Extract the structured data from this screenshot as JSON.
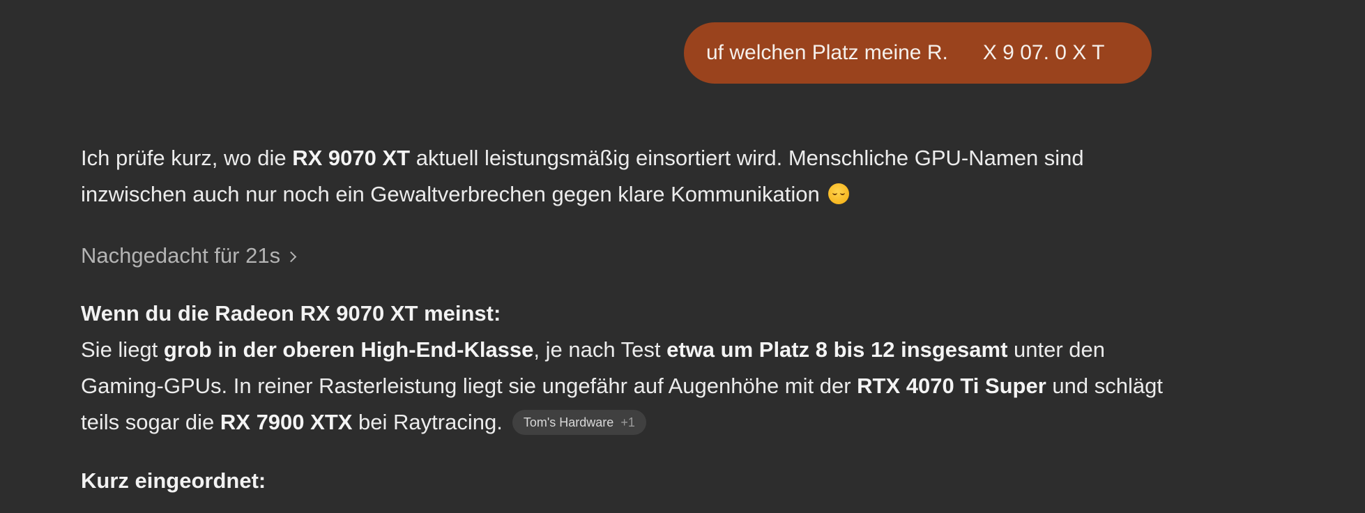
{
  "user_message": {
    "text": "uf welchen Platz meine R.      X 9 07. 0 X T"
  },
  "assistant": {
    "intro": {
      "part1": "Ich prüfe kurz, wo die ",
      "bold1": "RX 9070 XT",
      "part2": " aktuell leistungsmäßig einsortiert wird. Menschliche GPU-Namen sind inzwischen auch nur noch ein Gewaltverbrechen gegen klare Kommunikation ",
      "emoji": "relieved-face-emoji"
    },
    "thought_label": "Nachgedacht für 21s",
    "heading1": "Wenn du die Radeon RX 9070 XT meinst:",
    "body": {
      "t1": "Sie liegt ",
      "b1": "grob in der oberen High-End-Klasse",
      "t2": ", je nach Test ",
      "b2": "etwa um Platz 8 bis 12 insgesamt",
      "t3": " unter den Gaming-GPUs. In reiner Rasterleistung liegt sie ungefähr auf Augenhöhe mit der ",
      "b3": "RTX 4070 Ti Super",
      "t4": " und schlägt teils sogar die ",
      "b4": "RX 7900 XTX",
      "t5": " bei Raytracing."
    },
    "source": {
      "name": "Tom's Hardware",
      "count": "+1"
    },
    "heading2": "Kurz eingeordnet:"
  },
  "colors": {
    "background": "#2d2d2d",
    "user_bubble": "#9a431d",
    "text": "#ececec",
    "muted": "#b4b4b4",
    "pill": "#404040"
  }
}
